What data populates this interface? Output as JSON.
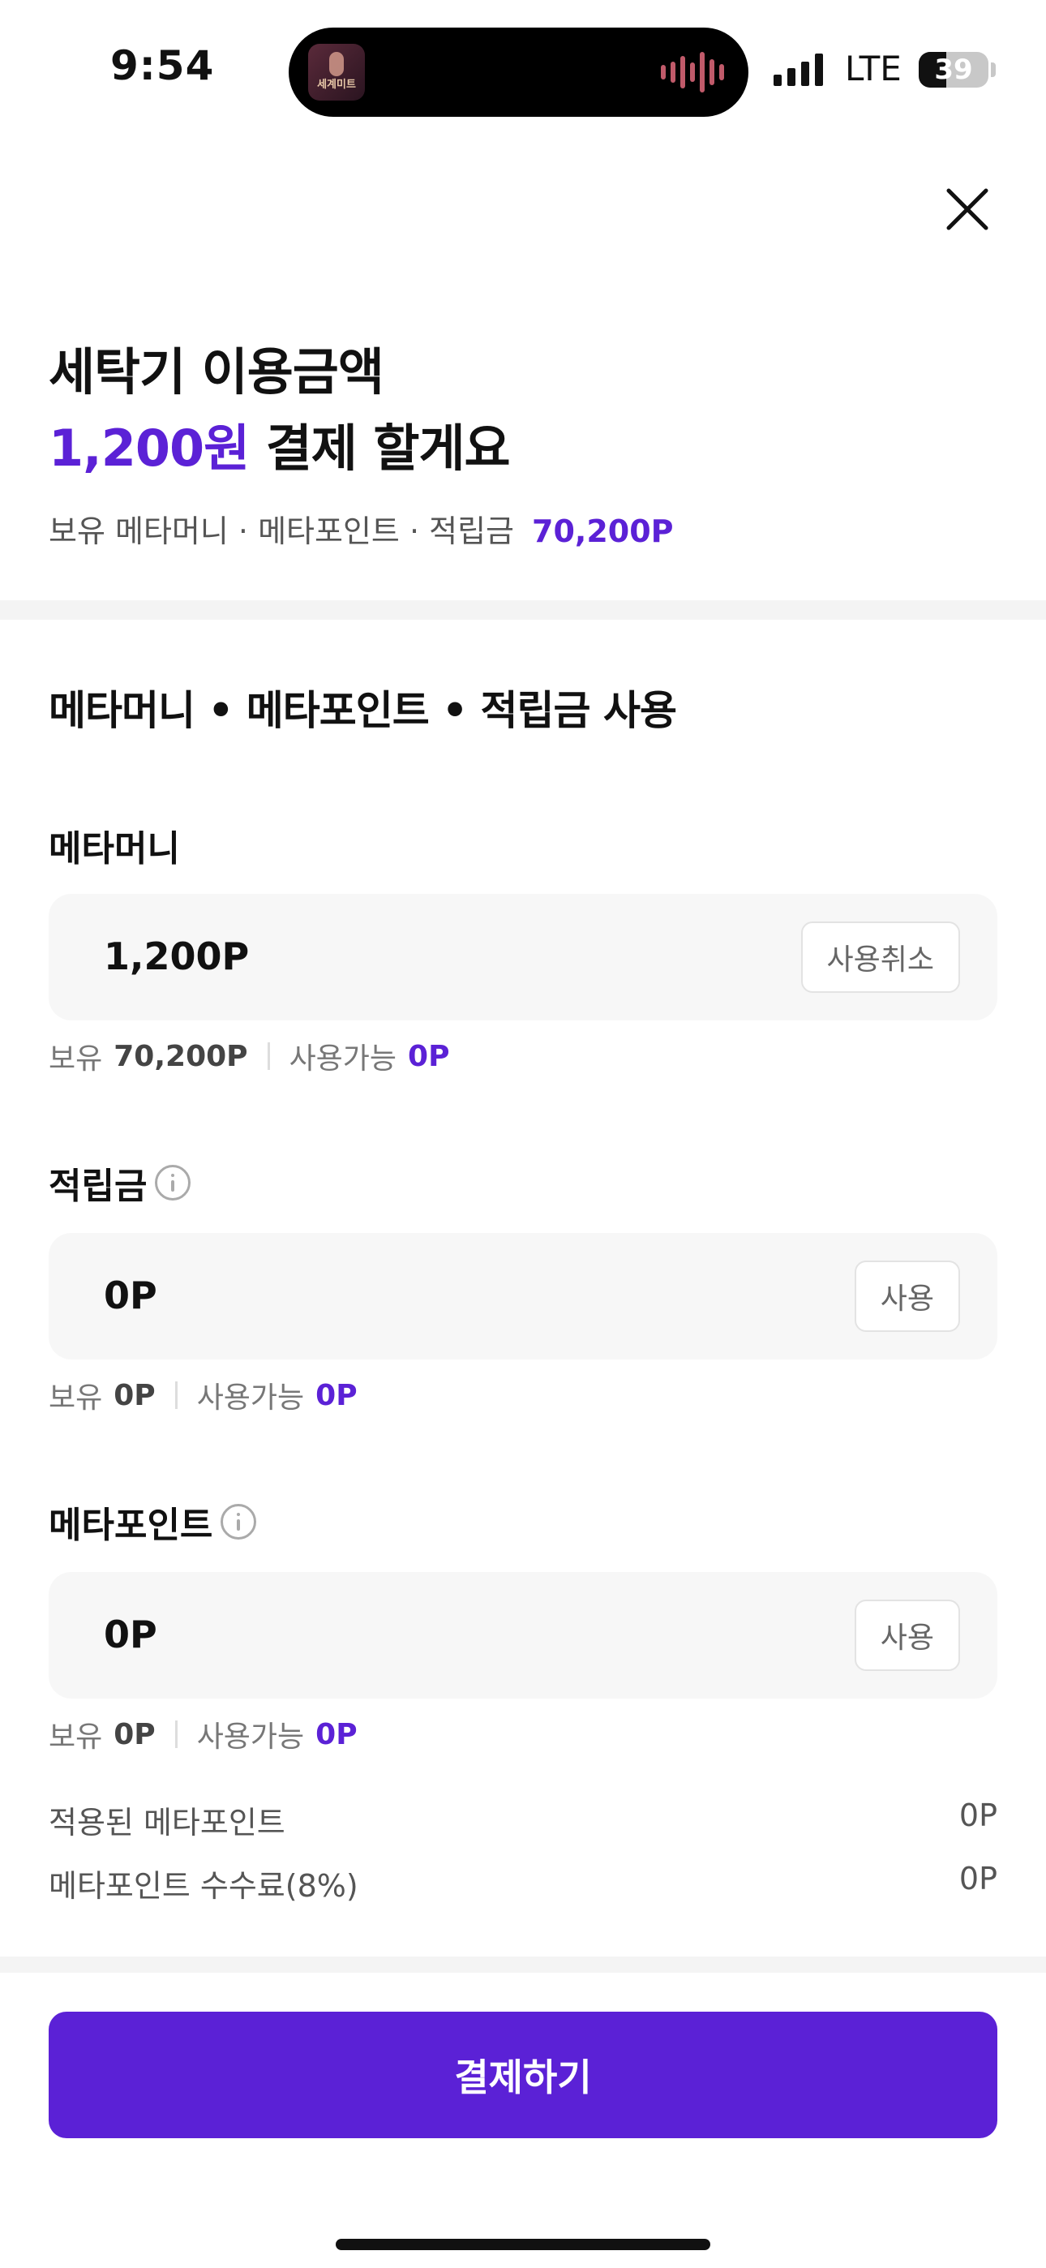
{
  "status_bar": {
    "time": "9:54",
    "network": "LTE",
    "battery": "39",
    "battery_level": 0.39,
    "now_playing_thumb_text": "세계미트"
  },
  "header": {
    "title_line1": "세탁기 이용금액",
    "amount": "1,200원",
    "title_suffix": " 결제 할게요",
    "holdings_label": "보유 메타머니 · 메타포인트 · 적립금",
    "holdings_value": "70,200P"
  },
  "section": {
    "title": "메타머니 • 메타포인트 • 적립금 사용"
  },
  "metamoney": {
    "label": "메타머니",
    "value": "1,200P",
    "button": "사용취소",
    "own_label": "보유",
    "own_value": "70,200P",
    "avail_label": "사용가능",
    "avail_value": "0P"
  },
  "reward": {
    "label": "적립금",
    "value": "0P",
    "button": "사용",
    "own_label": "보유",
    "own_value": "0P",
    "avail_label": "사용가능",
    "avail_value": "0P"
  },
  "metapoint": {
    "label": "메타포인트",
    "value": "0P",
    "button": "사용",
    "own_label": "보유",
    "own_value": "0P",
    "avail_label": "사용가능",
    "avail_value": "0P"
  },
  "summary": {
    "applied_label": "적용된 메타포인트",
    "applied_value": "0P",
    "fee_label": "메타포인트 수수료(8%)",
    "fee_value": "0P"
  },
  "pay_button": "결제하기",
  "colors": {
    "accent": "#5b21d6",
    "field_bg": "#f7f7f7",
    "divider": "#f4f4f4"
  },
  "icons": {
    "close": "close-icon",
    "info": "info-icon"
  }
}
